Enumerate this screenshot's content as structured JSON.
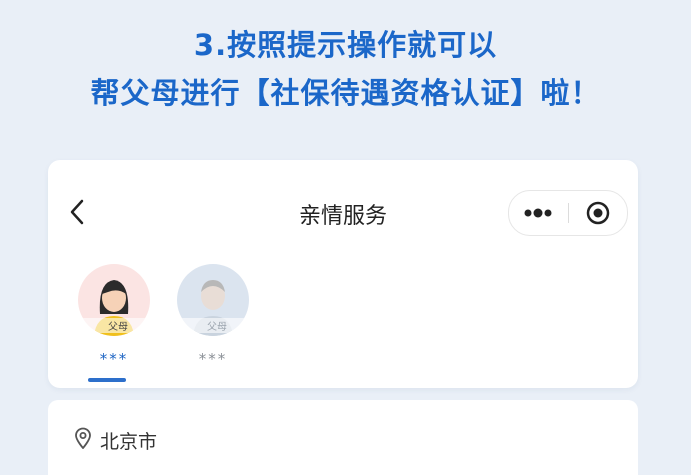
{
  "headline": {
    "line1": "3.按照提示操作就可以",
    "line2": "帮父母进行【社保待遇资格认证】啦！"
  },
  "nav": {
    "title": "亲情服务",
    "back_icon": "chevron-left-icon",
    "more_icon": "more-dots-icon",
    "close_icon": "target-close-icon"
  },
  "members": [
    {
      "label": "父母",
      "name": "***",
      "selected": true
    },
    {
      "label": "父母",
      "name": "***",
      "selected": false
    }
  ],
  "location": {
    "icon": "location-pin-icon",
    "text": "北京市"
  },
  "colors": {
    "headline": "#1b67c9",
    "background": "#e9eff7",
    "accent": "#2d6fcb"
  }
}
